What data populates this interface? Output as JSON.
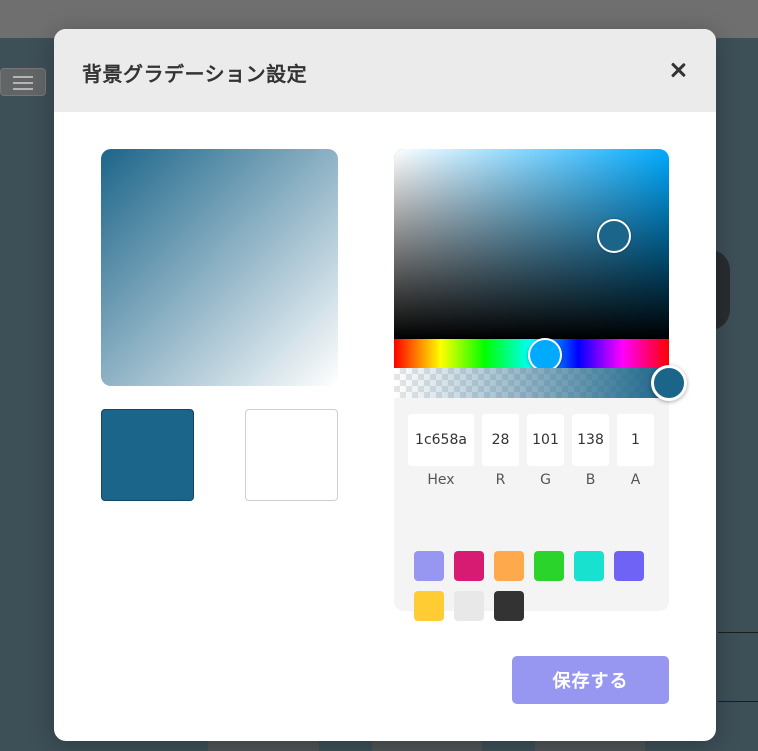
{
  "dialog": {
    "title": "背景グラデーション設定",
    "save_label": "保存する"
  },
  "gradient": {
    "start_color": "#1c658a",
    "end_color": "#ffffff",
    "direction": "top-left to bottom-right"
  },
  "picker": {
    "hue_color": "#00aaff",
    "selected_color": "#1c658a",
    "hue_position": 0.55,
    "saturation": 0.8,
    "value": 0.54,
    "alpha": 1,
    "fields": [
      {
        "value": "1c658a",
        "label": "Hex"
      },
      {
        "value": "28",
        "label": "R"
      },
      {
        "value": "101",
        "label": "G"
      },
      {
        "value": "138",
        "label": "B"
      },
      {
        "value": "1",
        "label": "A"
      }
    ],
    "presets": [
      "#9797f2",
      "#d81b72",
      "#ffa94d",
      "#2bd42b",
      "#19e1cf",
      "#6e63f5",
      "#ffcc33",
      "#e8e8e8",
      "#333333"
    ]
  }
}
